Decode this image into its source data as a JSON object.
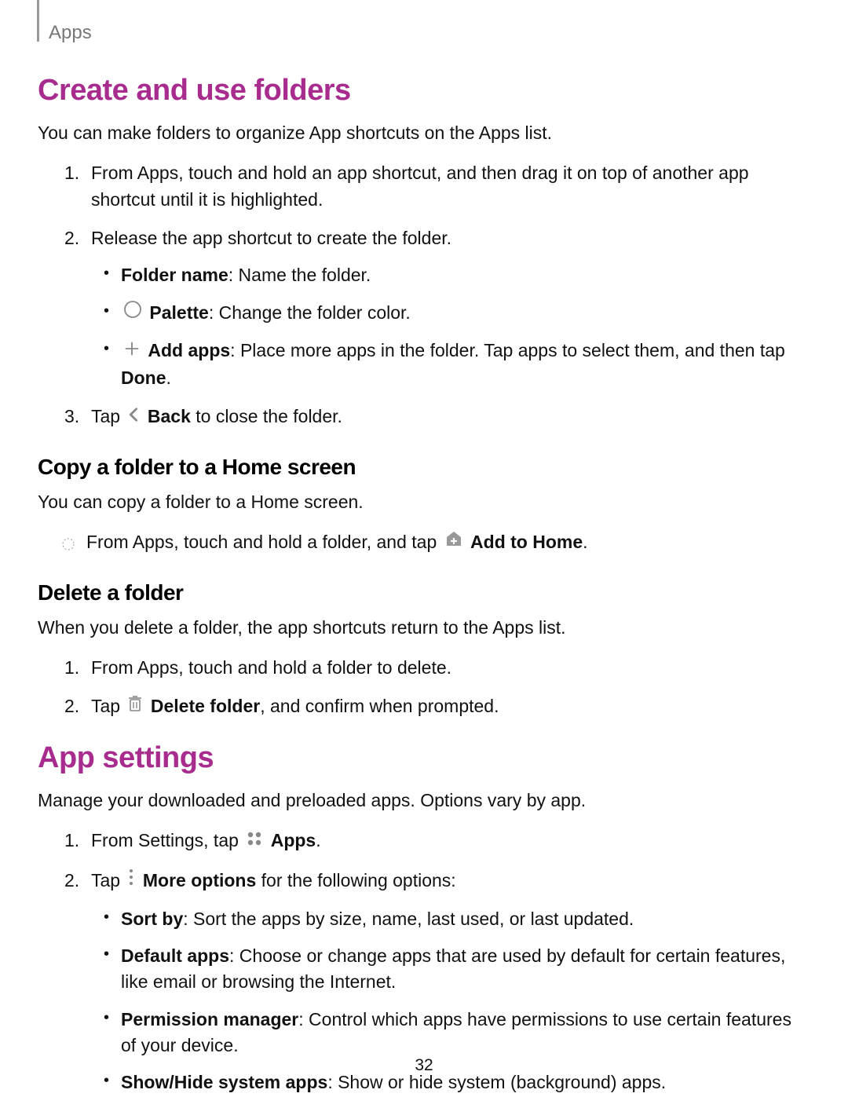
{
  "header": {
    "section": "Apps"
  },
  "section1": {
    "title": "Create and use folders",
    "intro": "You can make folders to organize App shortcuts on the Apps list.",
    "step1": "From Apps, touch and hold an app shortcut, and then drag it on top of another app shortcut until it is highlighted.",
    "step2": "Release the app shortcut to create the folder.",
    "sub_a_bold": "Folder name",
    "sub_a_text": ": Name the folder.",
    "sub_b_bold": "Palette",
    "sub_b_text": ": Change the folder color.",
    "sub_c_bold": "Add apps",
    "sub_c_text": ": Place more apps in the folder. Tap apps to select them, and then tap ",
    "sub_c_done": "Done",
    "sub_c_period": ".",
    "step3_pre": "Tap ",
    "step3_bold": "Back",
    "step3_post": " to close the folder."
  },
  "section2": {
    "title": "Copy a folder to a Home screen",
    "intro": "You can copy a folder to a Home screen.",
    "item_pre": "From Apps, touch and hold a folder, and tap ",
    "item_bold": "Add to Home",
    "item_post": "."
  },
  "section3": {
    "title": "Delete a folder",
    "intro": "When you delete a folder, the app shortcuts return to the Apps list.",
    "step1": "From Apps, touch and hold a folder to delete.",
    "step2_pre": "Tap ",
    "step2_bold": "Delete folder",
    "step2_post": ", and confirm when prompted."
  },
  "section4": {
    "title": "App settings",
    "intro": "Manage your downloaded and preloaded apps. Options vary by app.",
    "step1_pre": "From Settings, tap ",
    "step1_bold": "Apps",
    "step1_post": ".",
    "step2_pre": "Tap ",
    "step2_bold": "More options",
    "step2_post": " for the following options:",
    "opt_a_bold": "Sort by",
    "opt_a_text": ": Sort the apps by size, name, last used, or last updated.",
    "opt_b_bold": "Default apps",
    "opt_b_text": ": Choose or change apps that are used by default for certain features, like email or browsing the Internet.",
    "opt_c_bold": "Permission manager",
    "opt_c_text": ": Control which apps have permissions to use certain features of your device.",
    "opt_d_bold": "Show/Hide system apps",
    "opt_d_text": ": Show or hide system (background) apps."
  },
  "page_number": "32"
}
